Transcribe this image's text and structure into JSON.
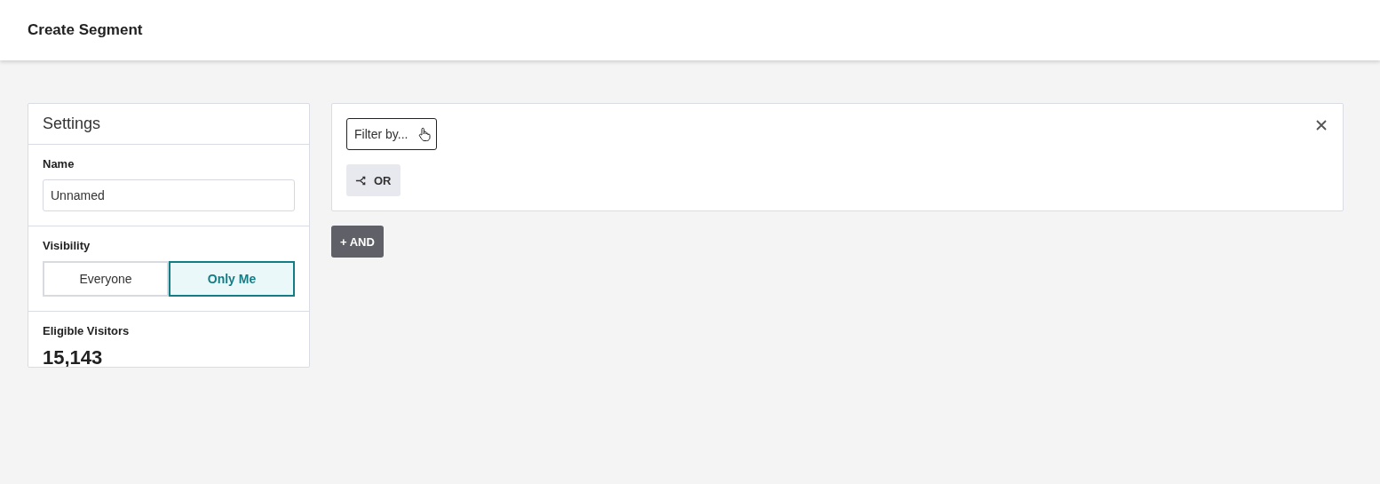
{
  "header": {
    "title": "Create Segment"
  },
  "settings": {
    "title": "Settings",
    "name_label": "Name",
    "name_value": "Unnamed",
    "visibility_label": "Visibility",
    "visibility_options": [
      {
        "label": "Everyone",
        "selected": false
      },
      {
        "label": "Only Me",
        "selected": true
      }
    ],
    "visitors_label": "Eligible Visitors",
    "visitors_count": "15,143"
  },
  "filter_group": {
    "filter_placeholder": "Filter by...",
    "or_button": "OR"
  },
  "and_button": "+ AND"
}
